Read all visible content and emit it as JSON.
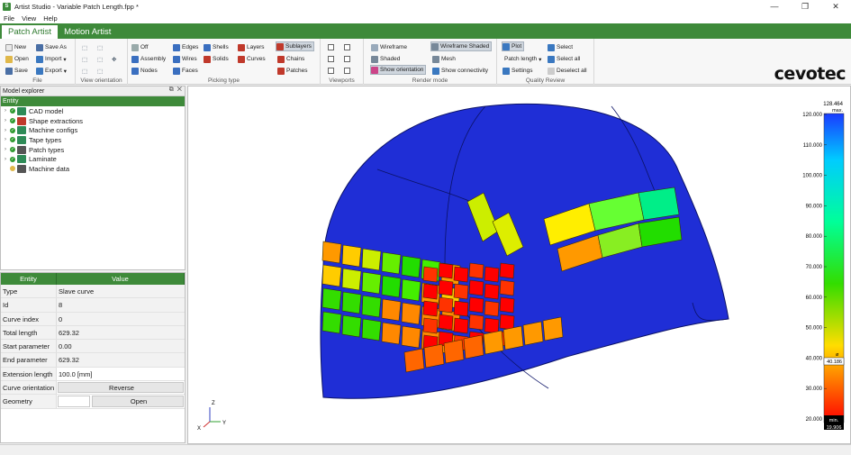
{
  "window": {
    "title": "Artist Studio - Variable Patch Length.fpp *",
    "icon": "app-logo-icon",
    "controls": [
      "—",
      "❐",
      "✕"
    ]
  },
  "menu": [
    "File",
    "View",
    "Help"
  ],
  "tabs": [
    "Patch Artist",
    "Motion Artist"
  ],
  "ribbon": {
    "file": {
      "label": "File",
      "new": "New",
      "save_as": "Save As",
      "open": "Open",
      "import": "Import",
      "save": "Save",
      "export": "Export"
    },
    "view_orientation": {
      "label": "View orientation"
    },
    "picking_type": {
      "label": "Picking type",
      "off": "Off",
      "edges": "Edges",
      "shells": "Shells",
      "layers": "Layers",
      "sublayers": "Sublayers",
      "assembly": "Assembly",
      "wires": "Wires",
      "solids": "Solids",
      "curves": "Curves",
      "chains": "Chains",
      "nodes": "Nodes",
      "faces": "Faces",
      "patches": "Patches"
    },
    "viewports": {
      "label": "Viewports"
    },
    "render_mode": {
      "label": "Render mode",
      "wireframe": "Wireframe",
      "wireframe_shaded": "Wireframe Shaded",
      "shaded": "Shaded",
      "mesh": "Mesh",
      "show_orientation": "Show orientation",
      "show_connectivity": "Show connectivity"
    },
    "quality_review": {
      "label": "Quality Review",
      "plot": "Plot",
      "select": "Select",
      "patch_length": "Patch length",
      "select_all": "Select all",
      "settings": "Settings",
      "deselect_all": "Deselect all"
    }
  },
  "brand": "cevotec",
  "explorer": {
    "title": "Model explorer",
    "column": "Entity",
    "items": [
      {
        "label": "CAD model",
        "icon": "cad-model-icon",
        "color": "#2e8b57"
      },
      {
        "label": "Shape extractions",
        "icon": "shape-extraction-icon",
        "color": "#c0392b"
      },
      {
        "label": "Machine configs",
        "icon": "machine-config-icon",
        "color": "#2e8b57"
      },
      {
        "label": "Tape types",
        "icon": "tape-type-icon",
        "color": "#2e8b57"
      },
      {
        "label": "Patch types",
        "icon": "patch-type-icon",
        "color": "#555555"
      },
      {
        "label": "Laminate",
        "icon": "laminate-icon",
        "color": "#2e8b57"
      },
      {
        "label": "Machine data",
        "icon": "machine-data-icon",
        "color": "#555555"
      }
    ]
  },
  "properties": {
    "headers": [
      "Entity",
      "Value"
    ],
    "rows": [
      {
        "key": "Type",
        "value": "Slave curve"
      },
      {
        "key": "Id",
        "value": "8"
      },
      {
        "key": "Curve index",
        "value": "0"
      },
      {
        "key": "Total length",
        "value": "629.32"
      },
      {
        "key": "Start parameter",
        "value": "0.00"
      },
      {
        "key": "End parameter",
        "value": "629.32"
      },
      {
        "key": "Extension length",
        "value": "100.0 [mm]"
      },
      {
        "key": "Curve orientation",
        "value": "Reverse"
      },
      {
        "key": "Geometry",
        "value": "Open"
      }
    ]
  },
  "axes": {
    "z": "Z",
    "x": "X",
    "y": "Y"
  },
  "colorbar": {
    "max_label": "128.464",
    "max_word": "max.",
    "min_word": "min.",
    "min_label": "19.906",
    "marker_value": "40.186",
    "marker_sym": "ø",
    "ticks": [
      "120.000",
      "110.000",
      "100.000",
      "90.000",
      "80.000",
      "70.000",
      "60.000",
      "50.000",
      "40.000",
      "30.000",
      "20.000"
    ]
  },
  "colors": {
    "accent": "#3e8a3a",
    "dome": "#1f2ed6"
  }
}
